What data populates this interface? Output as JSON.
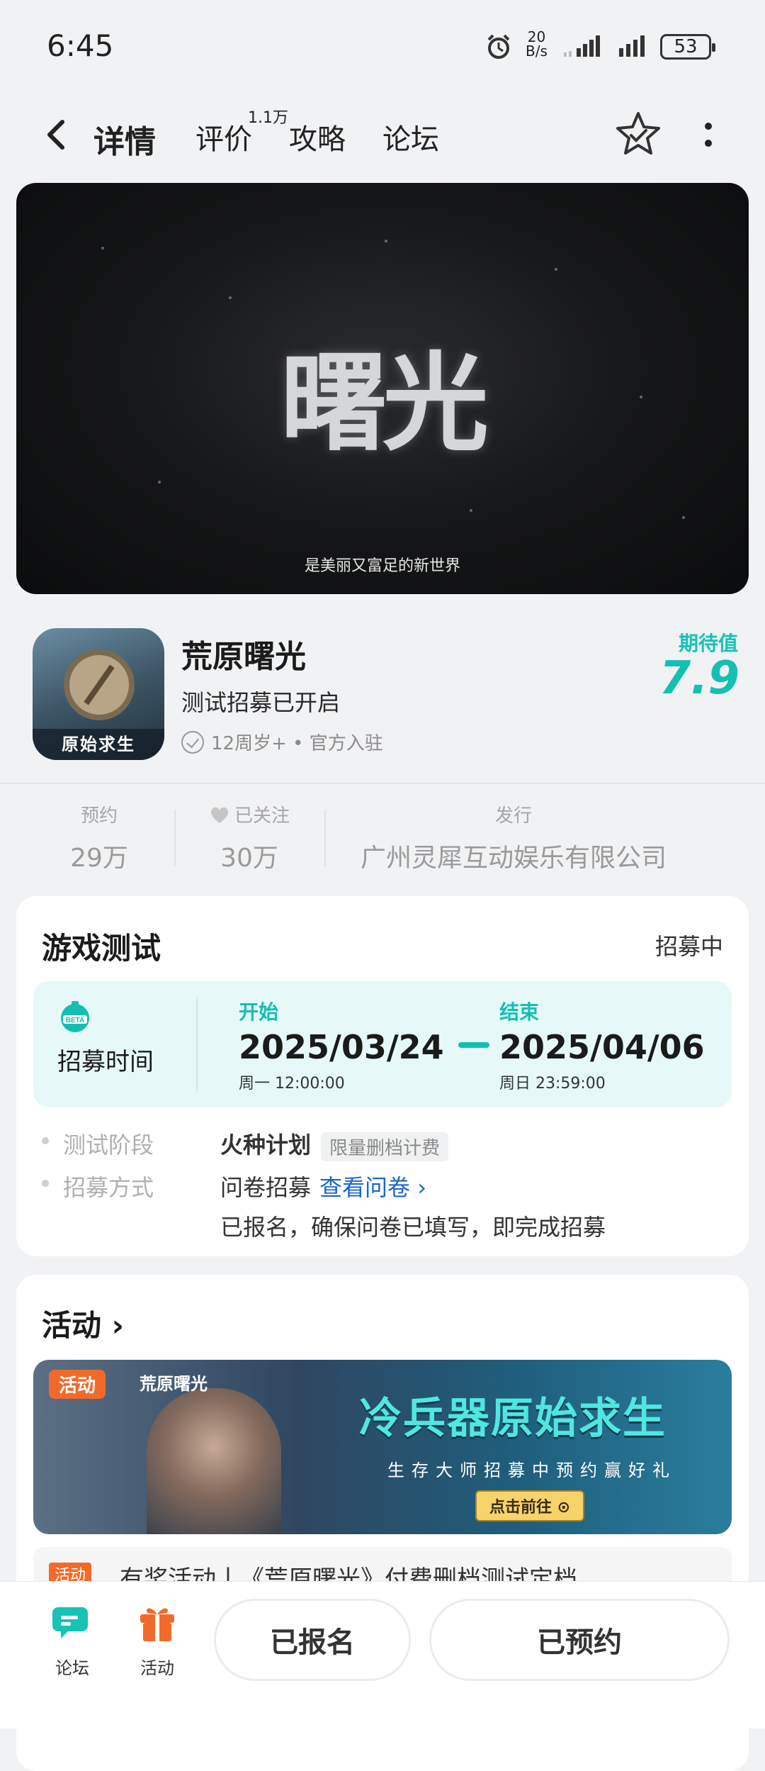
{
  "status_bar": {
    "time": "6:45",
    "net_speed_top": "20",
    "net_speed_unit": "B/s",
    "battery": "53"
  },
  "nav": {
    "tabs": [
      {
        "label": "详情",
        "active": true
      },
      {
        "label": "评价",
        "active": false
      },
      {
        "label": "攻略",
        "active": false
      },
      {
        "label": "论坛",
        "active": false
      }
    ],
    "review_count_badge": "1.1万",
    "icons": [
      "back-icon",
      "star-check-icon",
      "more-icon"
    ]
  },
  "banner": {
    "logo_text": "曙光",
    "caption": "是美丽又富足的新世界"
  },
  "game": {
    "title": "荒原曙光",
    "subtitle": "测试招募已开启",
    "meta": "12周岁+ • 官方入驻",
    "icon_tag": "原始求生",
    "expect_label": "期待值",
    "expect_value": "7.9",
    "accent": "#14c0b3"
  },
  "stats": [
    {
      "label": "预约",
      "value": "29万"
    },
    {
      "label": "已关注",
      "value": "30万"
    },
    {
      "label": "发行",
      "value": "广州灵犀互动娱乐有限公司"
    }
  ],
  "test_card": {
    "title": "游戏测试",
    "state": "招募中",
    "recruit_label": "招募时间",
    "start_key": "开始",
    "start_date": "2025/03/24",
    "start_week": "周一  12:00:00",
    "end_key": "结束",
    "end_date": "2025/04/06",
    "end_week": "周日  23:59:00",
    "stage_key": "测试阶段",
    "stage_value": "火种计划",
    "stage_pill": "限量删档计费",
    "method_key": "招募方式",
    "method_value": "问卷招募",
    "method_link": "查看问卷 ›",
    "method_note": "已报名，确保问卷已填写，即完成招募"
  },
  "activity_card": {
    "title": "活动 ›",
    "tag": "活动",
    "brand": "荒原曙光",
    "headline": "冷兵器原始求生",
    "subline": "生存大师招募中预约赢好礼",
    "button": "点击前往 ⊙",
    "peek_tag": "活动",
    "peek_text": "有奖活动丨《荒原曙光》付费删档测试定档"
  },
  "bottom_bar": {
    "forum_label": "论坛",
    "activity_label": "活动",
    "signed_up": "已报名",
    "reserved": "已预约"
  }
}
